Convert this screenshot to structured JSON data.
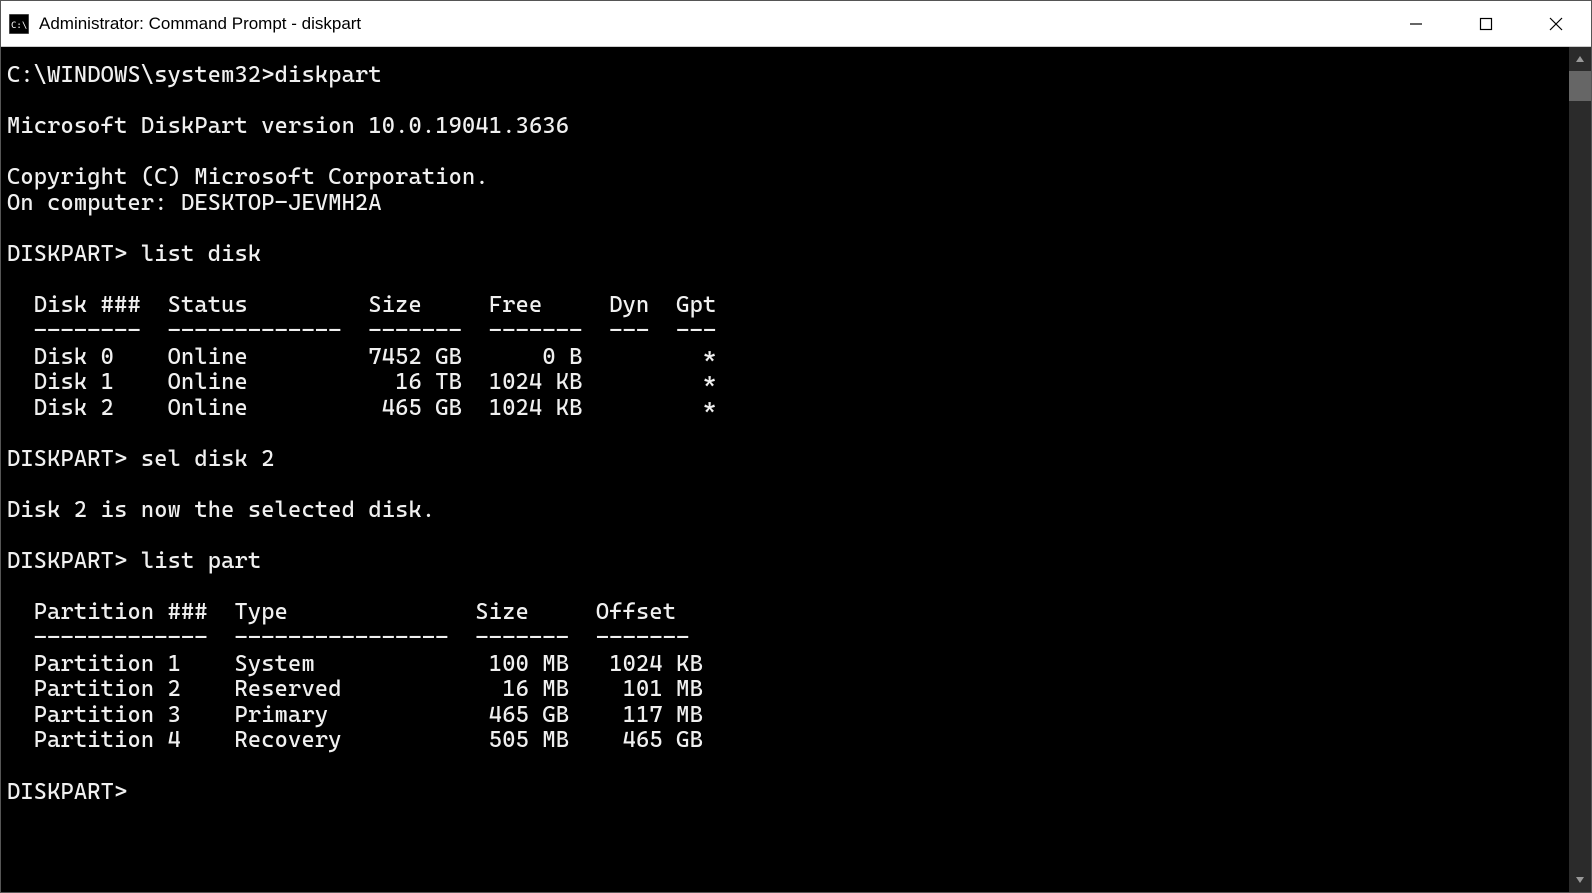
{
  "window": {
    "title": "Administrator: Command Prompt - diskpart"
  },
  "session": {
    "prompt_path": "C:\\WINDOWS\\system32>",
    "initial_command": "diskpart",
    "version_line": "Microsoft DiskPart version 10.0.19041.3636",
    "copyright_line": "Copyright (C) Microsoft Corporation.",
    "computer_line": "On computer: DESKTOP-JEVMH2A",
    "diskpart_prompt": "DISKPART>",
    "commands": {
      "list_disk": "list disk",
      "sel_disk": "sel disk 2",
      "list_part": "list part"
    },
    "sel_disk_response": "Disk 2 is now the selected disk.",
    "disk_table": {
      "headers": [
        "Disk ###",
        "Status",
        "Size",
        "Free",
        "Dyn",
        "Gpt"
      ],
      "rows": [
        {
          "disk": "Disk 0",
          "status": "Online",
          "size": "7452 GB",
          "free": "0 B",
          "dyn": "",
          "gpt": "*"
        },
        {
          "disk": "Disk 1",
          "status": "Online",
          "size": "16 TB",
          "free": "1024 KB",
          "dyn": "",
          "gpt": "*"
        },
        {
          "disk": "Disk 2",
          "status": "Online",
          "size": "465 GB",
          "free": "1024 KB",
          "dyn": "",
          "gpt": "*"
        }
      ]
    },
    "part_table": {
      "headers": [
        "Partition ###",
        "Type",
        "Size",
        "Offset"
      ],
      "rows": [
        {
          "part": "Partition 1",
          "type": "System",
          "size": "100 MB",
          "offset": "1024 KB"
        },
        {
          "part": "Partition 2",
          "type": "Reserved",
          "size": "16 MB",
          "offset": "101 MB"
        },
        {
          "part": "Partition 3",
          "type": "Primary",
          "size": "465 GB",
          "offset": "117 MB"
        },
        {
          "part": "Partition 4",
          "type": "Recovery",
          "size": "505 MB",
          "offset": "465 GB"
        }
      ]
    }
  }
}
